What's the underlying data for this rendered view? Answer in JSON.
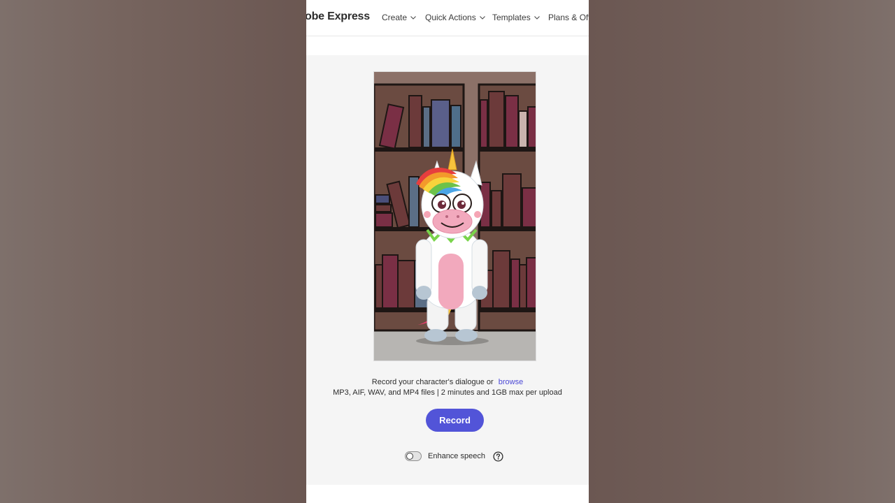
{
  "nav": {
    "brand": "obe Express",
    "items": [
      {
        "label": "Create"
      },
      {
        "label": "Quick Actions"
      },
      {
        "label": "Templates"
      },
      {
        "label": "Plans & Offe"
      }
    ]
  },
  "upload": {
    "prompt": "Record your character's dialogue or",
    "browse_label": "browse",
    "formats": "MP3, AIF, WAV, and MP4 files | 2 minutes and 1GB max per upload"
  },
  "record_label": "Record",
  "enhance": {
    "label": "Enhance speech",
    "enabled": false
  },
  "colors": {
    "accent": "#5254d8",
    "link": "#4b48d6",
    "panel_bg": "#f5f5f5",
    "wall": "#8c7168"
  },
  "icons": {
    "nav_chevron": "chevron-down-icon",
    "help": "question-circle-icon"
  }
}
